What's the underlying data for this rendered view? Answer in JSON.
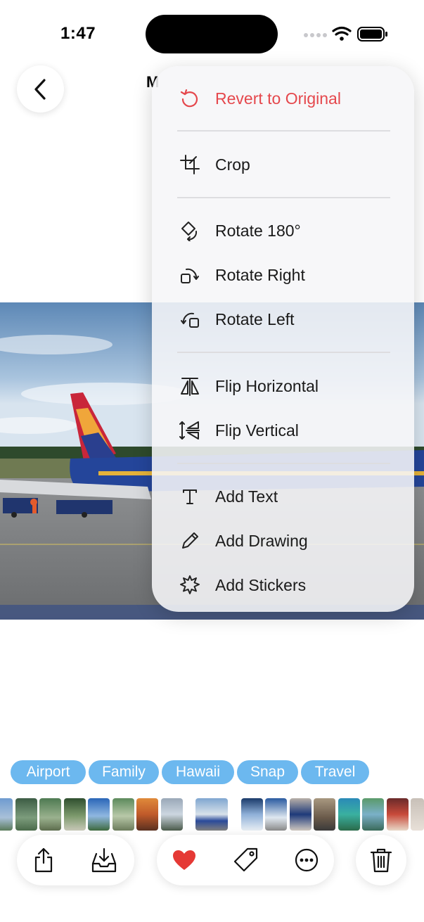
{
  "status_bar": {
    "time": "1:47"
  },
  "header": {
    "title_peek": "M"
  },
  "menu": {
    "items": [
      {
        "label": "Revert to Original",
        "icon": "revert-icon",
        "color": "#e5484d"
      },
      {
        "label": "Crop",
        "icon": "crop-icon"
      },
      {
        "label": "Rotate 180°",
        "icon": "rotate-180-icon"
      },
      {
        "label": "Rotate Right",
        "icon": "rotate-right-icon"
      },
      {
        "label": "Rotate Left",
        "icon": "rotate-left-icon"
      },
      {
        "label": "Flip Horizontal",
        "icon": "flip-horizontal-icon"
      },
      {
        "label": "Flip Vertical",
        "icon": "flip-vertical-icon"
      },
      {
        "label": "Add Text",
        "icon": "text-icon"
      },
      {
        "label": "Add Drawing",
        "icon": "pencil-icon"
      },
      {
        "label": "Add Stickers",
        "icon": "sticker-icon"
      }
    ]
  },
  "tags": [
    "Airport",
    "Family",
    "Hawaii",
    "Snap",
    "Travel"
  ],
  "colors": {
    "accent_tag": "#6cb8ef",
    "danger": "#e5484d",
    "favorite": "#e53935"
  },
  "toolbar": {
    "share": "share-icon",
    "save": "download-tray-icon",
    "favorite": "heart-icon",
    "tag": "tag-icon",
    "more": "ellipsis-circle-icon",
    "delete": "trash-icon"
  }
}
